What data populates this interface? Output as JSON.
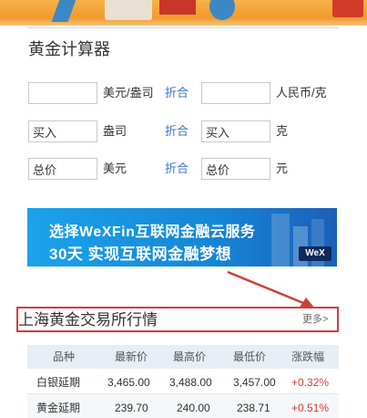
{
  "calculator": {
    "title": "黄金计算器",
    "row1": {
      "unit_left": "美元/盎司",
      "convert": "折合",
      "unit_right": "人民币/克"
    },
    "row2": {
      "input_left": "买入",
      "unit_left": "盎司",
      "convert": "折合",
      "input_right": "买入",
      "unit_right": "克"
    },
    "row3": {
      "input_left": "总价",
      "unit_left": "美元",
      "convert": "折合",
      "input_right": "总价",
      "unit_right": "元"
    }
  },
  "ad": {
    "line1": "选择WeXFin互联网金融云服务",
    "line2_highlight": "30天",
    "line2_rest": "实现互联网金融梦想",
    "logo": "WeX"
  },
  "market": {
    "title": "上海黄金交易所行情",
    "more": "更多>",
    "columns": [
      "品种",
      "最新价",
      "最高价",
      "最低价",
      "涨跌幅"
    ],
    "rows": [
      {
        "name": "白银延期",
        "latest": "3,465.00",
        "high": "3,488.00",
        "low": "3,457.00",
        "change": "+0.32%"
      },
      {
        "name": "黄金延期",
        "latest": "239.70",
        "high": "240.00",
        "low": "238.71",
        "change": "+0.51%"
      }
    ]
  },
  "colors": {
    "link": "#3a73c5",
    "highlight_box": "#d0403a",
    "change_up": "#d0403a",
    "ad_bg": "#1686d6"
  }
}
